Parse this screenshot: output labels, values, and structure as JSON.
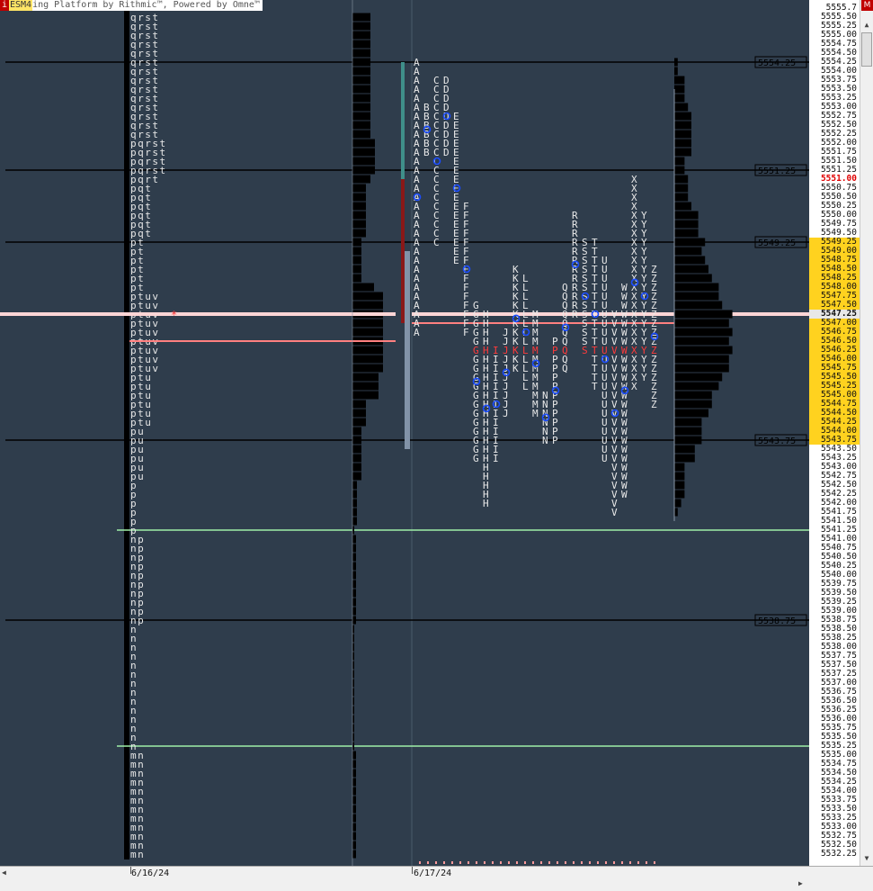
{
  "window": {
    "title_prefix": "i",
    "symbol": "ESM4",
    "title": "ing Platform by Rithmic™, Powered by Omne™",
    "max_button": "M"
  },
  "scale_values": [
    "5555.75",
    "5555.50",
    "5555.25",
    "5555.00",
    "5554.75",
    "5554.50",
    "5554.25",
    "5554.00",
    "5553.75",
    "5553.50",
    "5553.25",
    "5553.00",
    "5552.75",
    "5552.50",
    "5552.25",
    "5552.00",
    "5551.75",
    "5551.50",
    "5551.25",
    "5551.00",
    "5550.75",
    "5550.50",
    "5550.25",
    "5550.00",
    "5549.75",
    "5549.50",
    "5549.25",
    "5549.00",
    "5548.75",
    "5548.50",
    "5548.25",
    "5548.00",
    "5547.75",
    "5547.50",
    "5547.25",
    "5547.00",
    "5546.75",
    "5546.50",
    "5546.25",
    "5546.00",
    "5545.75",
    "5545.50",
    "5545.25",
    "5545.00",
    "5544.75",
    "5544.50",
    "5544.25",
    "5544.00",
    "5543.75",
    "5543.50",
    "5543.25",
    "5543.00",
    "5542.75",
    "5542.50",
    "5542.25",
    "5542.00",
    "5541.75",
    "5541.50",
    "5541.25",
    "5541.00",
    "5540.75",
    "5540.50",
    "5540.25",
    "5540.00",
    "5539.75",
    "5539.50",
    "5539.25",
    "5539.00",
    "5538.75",
    "5538.50",
    "5538.25",
    "5538.00",
    "5537.75",
    "5537.50",
    "5537.25",
    "5537.00",
    "5536.75",
    "5536.50",
    "5536.25",
    "5536.00",
    "5535.75",
    "5535.50",
    "5535.25",
    "5535.00",
    "5534.75",
    "5534.50",
    "5534.25",
    "5534.00",
    "5533.75",
    "5533.50",
    "5533.25",
    "5533.00",
    "5532.75",
    "5532.50",
    "5532.25"
  ],
  "scale_first_display": "5555.7",
  "last_price": "5551.00",
  "current_price": "5547.25",
  "value_area_top": "5549.25",
  "value_area_bottom": "5543.75",
  "level_lines": [
    "5554.25",
    "5551.25",
    "5549.25",
    "5543.75",
    "5538.75"
  ],
  "green_lines": [
    "5541.25",
    "5535.25"
  ],
  "dates": [
    "6/16/24",
    "6/17/24"
  ],
  "colors": {
    "background": "#2f3d4c",
    "value_area": "#ffd21f",
    "last_price": "#e00000",
    "level_line": "#000000",
    "green_line": "#9ff0a8",
    "poc_line": "#ff8080",
    "letters": "#e8e8e8",
    "single_print": "#ff3b3b",
    "open_marker": "#1a4cff"
  },
  "profile1": {
    "rows": [
      [
        "5555.50",
        "qrst"
      ],
      [
        "5555.25",
        "qrst"
      ],
      [
        "5555.00",
        "qrst"
      ],
      [
        "5554.75",
        "qrst"
      ],
      [
        "5554.50",
        "qrst"
      ],
      [
        "5554.25",
        "qrst"
      ],
      [
        "5554.00",
        "qrst"
      ],
      [
        "5553.75",
        "qrst"
      ],
      [
        "5553.50",
        "qrst"
      ],
      [
        "5553.25",
        "qrst"
      ],
      [
        "5553.00",
        "qrst"
      ],
      [
        "5552.75",
        "qrst"
      ],
      [
        "5552.50",
        "qrst"
      ],
      [
        "5552.25",
        "qrst"
      ],
      [
        "5552.00",
        "pqrst"
      ],
      [
        "5551.75",
        "pqrst"
      ],
      [
        "5551.50",
        "pqrst"
      ],
      [
        "5551.25",
        "pqrst"
      ],
      [
        "5551.00",
        "pqrt"
      ],
      [
        "5550.75",
        "pqt"
      ],
      [
        "5550.50",
        "pqt"
      ],
      [
        "5550.25",
        "pqt"
      ],
      [
        "5550.00",
        "pqt"
      ],
      [
        "5549.75",
        "pqt"
      ],
      [
        "5549.50",
        "pqt"
      ],
      [
        "5549.25",
        "pt"
      ],
      [
        "5549.00",
        "pt"
      ],
      [
        "5548.75",
        "pt"
      ],
      [
        "5548.50",
        "pt"
      ],
      [
        "5548.25",
        "pt"
      ],
      [
        "5548.00",
        "pt"
      ],
      [
        "5547.75",
        "ptuv"
      ],
      [
        "5547.50",
        "ptuv"
      ],
      [
        "5547.25",
        "ptuv"
      ],
      [
        "5547.00",
        "ptuv"
      ],
      [
        "5546.75",
        "ptuv"
      ],
      [
        "5546.50",
        "ptuv"
      ],
      [
        "5546.25",
        "ptuv"
      ],
      [
        "5546.00",
        "ptuv"
      ],
      [
        "5545.75",
        "ptuv"
      ],
      [
        "5545.50",
        "ptu"
      ],
      [
        "5545.25",
        "ptu"
      ],
      [
        "5545.00",
        "ptu"
      ],
      [
        "5544.75",
        "ptu"
      ],
      [
        "5544.50",
        "ptu"
      ],
      [
        "5544.25",
        "ptu"
      ],
      [
        "5544.00",
        "pu"
      ],
      [
        "5543.75",
        "pu"
      ],
      [
        "5543.50",
        "pu"
      ],
      [
        "5543.25",
        "pu"
      ],
      [
        "5543.00",
        "pu"
      ],
      [
        "5542.75",
        "pu"
      ],
      [
        "5542.50",
        "p"
      ],
      [
        "5542.25",
        "p"
      ],
      [
        "5542.00",
        "p"
      ],
      [
        "5541.75",
        "p"
      ],
      [
        "5541.50",
        "p"
      ],
      [
        "5541.25",
        "p"
      ],
      [
        "5541.00",
        "np"
      ],
      [
        "5540.75",
        "np"
      ],
      [
        "5540.50",
        "np"
      ],
      [
        "5540.25",
        "np"
      ],
      [
        "5540.00",
        "np"
      ],
      [
        "5539.75",
        "np"
      ],
      [
        "5539.50",
        "np"
      ],
      [
        "5539.25",
        "np"
      ],
      [
        "5539.00",
        "np"
      ],
      [
        "5538.75",
        "np"
      ],
      [
        "5538.50",
        "n"
      ],
      [
        "5538.25",
        "n"
      ],
      [
        "5538.00",
        "n"
      ],
      [
        "5537.75",
        "n"
      ],
      [
        "5537.50",
        "n"
      ],
      [
        "5537.25",
        "n"
      ],
      [
        "5537.00",
        "n"
      ],
      [
        "5536.75",
        "n"
      ],
      [
        "5536.50",
        "n"
      ],
      [
        "5536.25",
        "n"
      ],
      [
        "5536.00",
        "n"
      ],
      [
        "5535.75",
        "n"
      ],
      [
        "5535.50",
        "n"
      ],
      [
        "5535.25",
        "n"
      ],
      [
        "5535.00",
        "mn"
      ],
      [
        "5534.75",
        "mn"
      ],
      [
        "5534.50",
        "mn"
      ],
      [
        "5534.25",
        "mn"
      ],
      [
        "5534.00",
        "mn"
      ],
      [
        "5533.75",
        "mn"
      ],
      [
        "5533.50",
        "mn"
      ],
      [
        "5533.25",
        "mn"
      ],
      [
        "5533.00",
        "mn"
      ],
      [
        "5532.75",
        "mn"
      ],
      [
        "5532.50",
        "mn"
      ],
      [
        "5532.25",
        "mn"
      ]
    ]
  },
  "profile2_columns": [
    {
      "letter": "A",
      "from": "5554.25",
      "to": "5546.75",
      "single_at": "5546.25"
    },
    {
      "letter": "B",
      "from": "5553.00",
      "to": "5551.75"
    },
    {
      "letter": "C",
      "from": "5553.75",
      "to": "5549.25"
    },
    {
      "letter": "D",
      "from": "5553.75",
      "to": "5551.75"
    },
    {
      "letter": "E",
      "from": "5552.75",
      "to": "5548.75"
    },
    {
      "letter": "F",
      "from": "5550.25",
      "to": "5546.75"
    },
    {
      "letter": "G",
      "from": "5547.50",
      "to": "5543.25",
      "single_at": "5546.25"
    },
    {
      "letter": "H",
      "from": "5547.25",
      "to": "5542.00",
      "single_at": "5546.25"
    },
    {
      "letter": "I",
      "from": "5546.25",
      "to": "5543.25",
      "single_at": "5546.25"
    },
    {
      "letter": "J",
      "from": "5546.75",
      "to": "5544.50",
      "single_at": "5546.25"
    },
    {
      "letter": "K",
      "from": "5548.50",
      "to": "5545.75",
      "single_at": "5546.25"
    },
    {
      "letter": "L",
      "from": "5548.25",
      "to": "5545.25",
      "single_at": "5546.25"
    },
    {
      "letter": "M",
      "from": "5547.25",
      "to": "5544.50",
      "single_at": "5546.25"
    },
    {
      "letter": "N",
      "from": "5545.00",
      "to": "5543.75"
    },
    {
      "letter": "P",
      "from": "5546.50",
      "to": "5543.75",
      "single_at": "5546.25"
    },
    {
      "letter": "Q",
      "from": "5548.00",
      "to": "5545.75",
      "single_at": "5546.25"
    },
    {
      "letter": "R",
      "from": "5550.00",
      "to": "5547.25"
    },
    {
      "letter": "S",
      "from": "5549.25",
      "to": "5546.25",
      "single_at": "5546.25"
    },
    {
      "letter": "T",
      "from": "5549.25",
      "to": "5545.25",
      "single_at": "5546.25"
    },
    {
      "letter": "U",
      "from": "5548.75",
      "to": "5543.25",
      "single_at": "5546.25"
    },
    {
      "letter": "V",
      "from": "5547.25",
      "to": "5541.75",
      "single_at": "5546.25"
    },
    {
      "letter": "W",
      "from": "5548.00",
      "to": "5542.25",
      "single_at": "5546.25"
    },
    {
      "letter": "X",
      "from": "5551.00",
      "to": "5545.25",
      "single_at": "5546.25"
    },
    {
      "letter": "Y",
      "from": "5550.00",
      "to": "5545.50",
      "single_at": "5546.25"
    },
    {
      "letter": "Z",
      "from": "5548.50",
      "to": "5544.75",
      "single_at": "5546.25"
    }
  ]
}
